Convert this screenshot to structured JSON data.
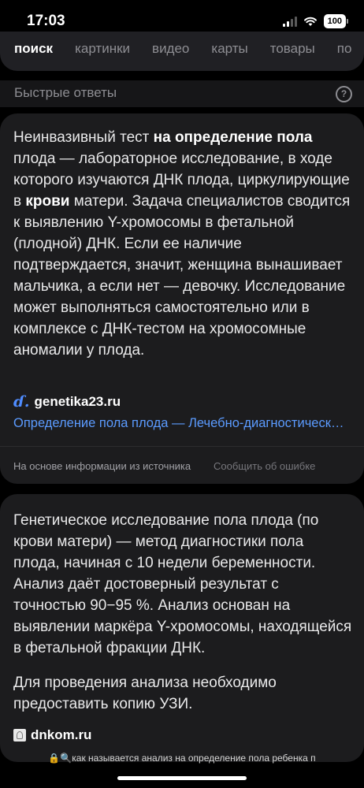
{
  "status_bar": {
    "time": "17:03",
    "battery": "100"
  },
  "tabs": [
    {
      "label": "поиск",
      "active": true
    },
    {
      "label": "картинки"
    },
    {
      "label": "видео"
    },
    {
      "label": "карты"
    },
    {
      "label": "товары"
    },
    {
      "label": "по"
    }
  ],
  "quick_answers": {
    "title": "Быстрые ответы",
    "help_icon": "question-circle-icon"
  },
  "card1": {
    "text_segments": [
      {
        "text": "Неинвазивный тест ",
        "bold": false
      },
      {
        "text": "на определение пола",
        "bold": true
      },
      {
        "text": " плода — лабораторное исследование, в ходе которого изучаются ДНК плода, циркулирующие в ",
        "bold": false
      },
      {
        "text": "крови",
        "bold": true
      },
      {
        "text": " матери. Задача специалистов сводится к выявлению Y-хромосомы в фетальной (плодной) ДНК. Если ее наличие подтверждается, значит, женщина вынашивает мальчика, а если нет — девочку. Исследование может выполняться самостоятельно или в комплексе с ДНК-тестом на хромосомные аномалии у плода.",
        "bold": false
      }
    ],
    "source_logo": "ɗ.",
    "source_name": "genetika23.ru",
    "source_link": "Определение пола плода — Лечебно-диагностический центр",
    "footer_note": "На основе информации из источника",
    "report_label": "Сообщить об ошибке"
  },
  "card2": {
    "paragraph1": "Генетическое исследование пола плода (по крови матери) — метод диагностики пола плода, начиная с 10 недели беременности. Анализ даёт достоверный результат с точностью 90−95 %. Анализ основан на выявлении маркёра Y-хромосомы, находящейся в фетальной фракции ДНК.",
    "paragraph2": "Для проведения анализа необходимо предоставить копию УЗИ.",
    "source_name": "dnkom.ru"
  },
  "url_bar": {
    "text": "🔒🔍как называется анализ на определение пола ребенка п"
  }
}
